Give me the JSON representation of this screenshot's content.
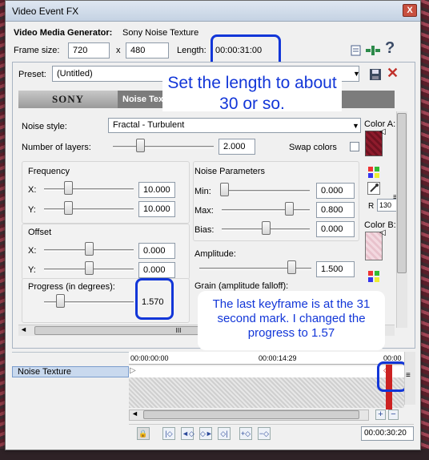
{
  "window": {
    "title": "Video Event FX",
    "close": "X"
  },
  "generator": {
    "label": "Video Media Generator:",
    "name": "Sony Noise Texture"
  },
  "frame": {
    "label": "Frame size:",
    "width": "720",
    "x": "x",
    "height": "480",
    "length_label": "Length:",
    "length": "00:00:31:00"
  },
  "toolbar_icons": [
    "properties-icon",
    "plugin-chain-icon",
    "help-icon"
  ],
  "help_glyph": "?",
  "preset": {
    "label": "Preset:",
    "value": "(Untitled)"
  },
  "header": {
    "brand": "SONY",
    "tab": "Noise Texture"
  },
  "noise_style": {
    "label": "Noise style:",
    "value": "Fractal - Turbulent"
  },
  "layers": {
    "label": "Number of layers:",
    "value": "2.000",
    "level": 0.25
  },
  "swap": {
    "label": "Swap colors"
  },
  "color_a": {
    "label": "Color A:",
    "r_label": "R",
    "r_value": "130"
  },
  "color_b": {
    "label": "Color B:"
  },
  "frequency": {
    "title": "Frequency",
    "x_label": "X:",
    "x_value": "10.000",
    "x_level": 0.25,
    "y_label": "Y:",
    "y_value": "10.000",
    "y_level": 0.25
  },
  "offset": {
    "title": "Offset",
    "x_label": "X:",
    "x_value": "0.000",
    "x_level": 0.5,
    "y_label": "Y:",
    "y_value": "0.000",
    "y_level": 0.5
  },
  "progress": {
    "label": "Progress (in degrees):",
    "value": "1.570",
    "level": 0.15
  },
  "noise_params": {
    "title": "Noise Parameters",
    "min_label": "Min:",
    "min_value": "0.000",
    "min_level": 0.0,
    "max_label": "Max:",
    "max_value": "0.800",
    "max_level": 0.8,
    "bias_label": "Bias:",
    "bias_value": "0.000",
    "bias_level": 0.5
  },
  "amplitude": {
    "label": "Amplitude:",
    "value": "1.500",
    "level": 0.85
  },
  "grain": {
    "label": "Grain (amplitude falloff):"
  },
  "scroll_label": "III",
  "timeline": {
    "track_label": "Noise Texture",
    "t_start": "00:00:00:00",
    "t_mid": "00:00:14:29",
    "t_end": "00:00",
    "cursor_time": "00:00:30:20",
    "zoom_plus": "+",
    "zoom_minus": "−"
  },
  "annotations": {
    "length_note": "Set the length to about 30 or so.",
    "keyframe_note": "The last keyframe is at the 31 second mark.  I changed the progress to 1.57"
  },
  "colors": {
    "accent_blue": "#1236d8",
    "color_a": "#8e1b2c",
    "color_b": "#f3d9e0"
  }
}
